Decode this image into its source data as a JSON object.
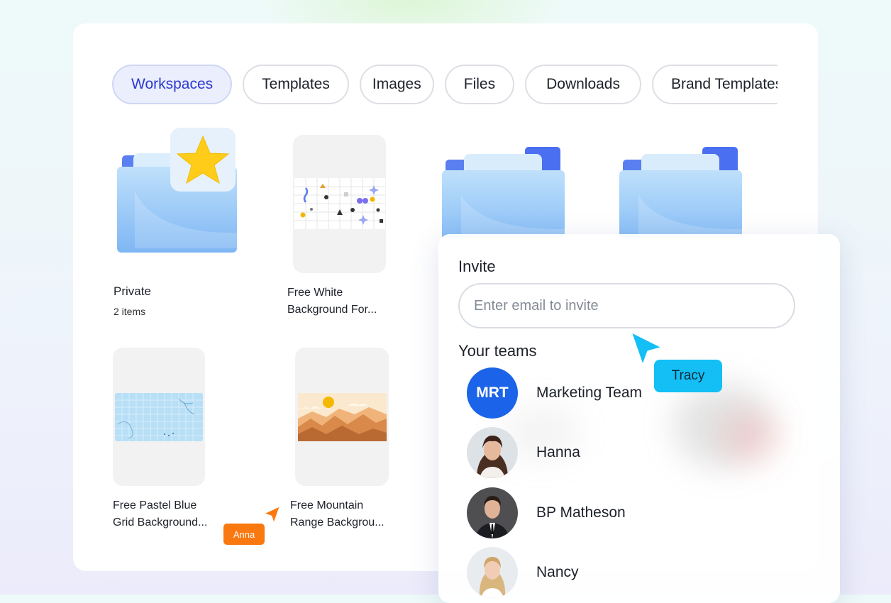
{
  "tabs": [
    {
      "label": "Workspaces",
      "active": true
    },
    {
      "label": "Templates",
      "active": false
    },
    {
      "label": "Images",
      "active": false
    },
    {
      "label": "Files",
      "active": false
    },
    {
      "label": "Downloads",
      "active": false
    },
    {
      "label": "Brand Templates",
      "active": false
    }
  ],
  "items": {
    "private": {
      "title": "Private",
      "subtitle": "2 items"
    },
    "free_white": {
      "title": "Free White\nBackground For..."
    },
    "pastel_blue": {
      "title": "Free Pastel Blue\nGrid Background..."
    },
    "mountain": {
      "title": "Free Mountain\nRange Backgrou..."
    }
  },
  "invite": {
    "title": "Invite",
    "email_value": "",
    "email_placeholder": "Enter email to invite",
    "teams_title": "Your teams",
    "members": [
      {
        "name": "Marketing Team",
        "initials": "MRT",
        "type": "team"
      },
      {
        "name": "Hanna",
        "type": "person"
      },
      {
        "name": "BP Matheson",
        "type": "person"
      },
      {
        "name": "Nancy",
        "type": "person"
      }
    ]
  },
  "cursors": [
    {
      "label": "Tracy",
      "color": "#13bff5"
    },
    {
      "label": "Anna",
      "color": "#fa7810"
    }
  ],
  "colors": {
    "accent": "#2d3ad0",
    "folder_blue": "#8ec2f7",
    "team_avatar": "#1b63e8",
    "star": "#ffcc1a"
  }
}
